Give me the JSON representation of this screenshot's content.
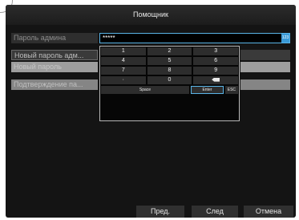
{
  "dialog": {
    "title": "Помощник"
  },
  "form": {
    "admin_label": "Пароль админа",
    "admin_value": "*****",
    "input_mode_label": "123",
    "new_admin_label": "Новый пароль адм...",
    "new_pass_label": "Новый пароль",
    "confirm_label": "Подтверждение па..."
  },
  "keypad": {
    "rows": [
      [
        "1",
        "2",
        "3"
      ],
      [
        "4",
        "5",
        "6"
      ],
      [
        "7",
        "8",
        "9"
      ],
      [
        "·",
        "0"
      ]
    ],
    "space_label": "Space",
    "enter_label": "Enter",
    "esc_label": "ESC"
  },
  "footer": {
    "prev_label": "Пред.",
    "next_label": "След",
    "cancel_label": "Отмена"
  }
}
